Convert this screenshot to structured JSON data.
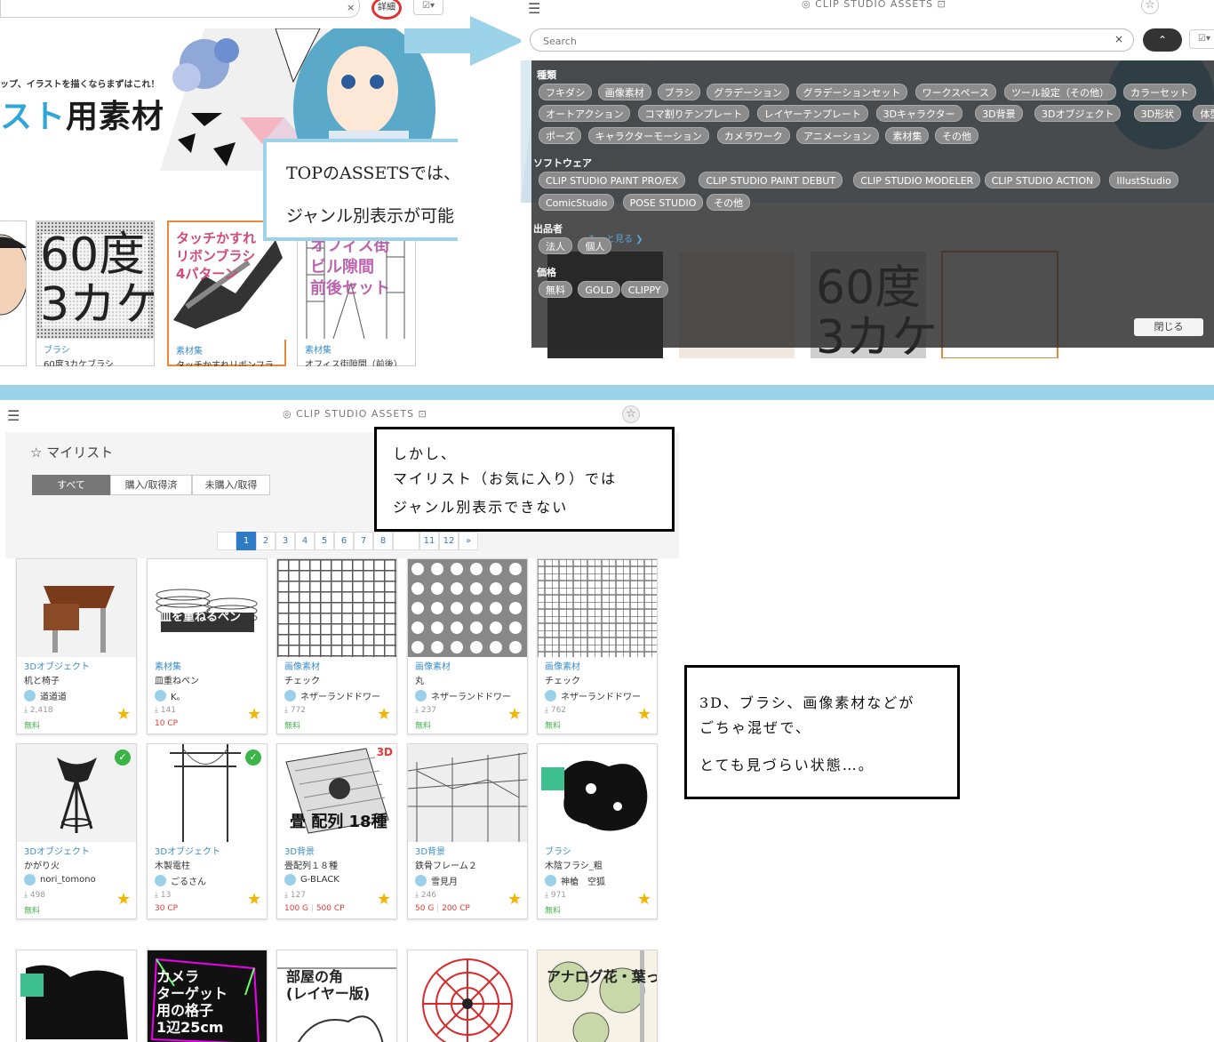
{
  "top_left": {
    "close_x": "×",
    "detail_label": "詳細",
    "check_label": "☑▾",
    "banner_line1": "ップ、イラストを描くならまずはこれ！",
    "banner_line2_accent": "スト",
    "banner_line2_rest": "用素材",
    "cards": [
      {
        "thumb_text": "60度\n3カケ",
        "category": "ブラシ",
        "name": "60度3カケブラシ"
      },
      {
        "thumb_text": "タッチかすれ\nリボンブラシ\n4パターン",
        "category": "素材集",
        "name": "タッチかすれリボンフラ"
      },
      {
        "thumb_text": "オフィス街\nビル隙間\n前後セット",
        "category": "素材集",
        "name": "オフィス街隙間（前後）"
      }
    ],
    "callout_line1": "TOPのASSETSでは、",
    "callout_line2": "ジャンル別表示が可能"
  },
  "top_right": {
    "header_title": "CLIP STUDIO ASSETS",
    "search_placeholder": "Search",
    "close_x": "×",
    "up_label": "⌃",
    "check_label": "☑▾",
    "sections": {
      "kind": "種類",
      "software": "ソフトウェア",
      "author": "出品者",
      "price": "価格"
    },
    "kind_chips": [
      "フキダシ",
      "画像素材",
      "ブラシ",
      "グラデーション",
      "グラデーションセット",
      "ワークスペース",
      "ツール設定（その他）",
      "カラーセット",
      "オートアクション",
      "コマ割りテンプレート",
      "レイヤーテンプレート",
      "3Dキャラクター",
      "3D背景",
      "3Dオブジェクト",
      "3D形状",
      "体型",
      "ポーズ",
      "キャラクターモーション",
      "カメラワーク",
      "アニメーション",
      "素材集",
      "その他"
    ],
    "software_chips": [
      "CLIP STUDIO PAINT PRO/EX",
      "CLIP STUDIO PAINT DEBUT",
      "CLIP STUDIO MODELER",
      "CLIP STUDIO ACTION",
      "IllustStudio",
      "ComicStudio",
      "POSE STUDIO",
      "その他"
    ],
    "author_chips": [
      "法人",
      "個人"
    ],
    "more_link": "もっと見る ❯",
    "price_chips": [
      "無料",
      "GOLD",
      "CLIPPY"
    ],
    "close_button": "閉じる"
  },
  "bottom": {
    "header_title": "CLIP STUDIO ASSETS",
    "mylist_title": "☆ マイリスト",
    "tabs": [
      "すべて",
      "購入/取得済",
      "未購入/取得"
    ],
    "pages": [
      "",
      "1",
      "2",
      "3",
      "4",
      "5",
      "6",
      "7",
      "8",
      "",
      "11",
      "12",
      "»"
    ],
    "callout1": [
      "しかし、",
      "マイリスト（お気に入り）では",
      "ジャンル別表示できない"
    ],
    "callout2": [
      "3D、ブラシ、画像素材などが",
      "ごちゃ混ぜで、",
      "とても見づらい状態…。"
    ],
    "cards": [
      {
        "category": "3Dオブジェクト",
        "name": "机と椅子",
        "author": "道道道",
        "downloads": "2,418",
        "price": "無料",
        "price_cp": ""
      },
      {
        "category": "素材集",
        "name": "皿重ねペン",
        "author": "K。",
        "downloads": "141",
        "price": "",
        "price_cp": "10 CP",
        "thumb_text": "皿を重ねるペン"
      },
      {
        "category": "画像素材",
        "name": "チェック",
        "author": "ネザーランドドワー",
        "downloads": "772",
        "price": "無料",
        "price_cp": ""
      },
      {
        "category": "画像素材",
        "name": "丸",
        "author": "ネザーランドドワー",
        "downloads": "237",
        "price": "無料",
        "price_cp": ""
      },
      {
        "category": "画像素材",
        "name": "チェック",
        "author": "ネザーランドドワー",
        "downloads": "762",
        "price": "無料",
        "price_cp": ""
      },
      {
        "category": "3Dオブジェクト",
        "name": "かがり火",
        "author": "nori_tomono",
        "downloads": "498",
        "price": "無料",
        "price_cp": ""
      },
      {
        "category": "3Dオブジェクト",
        "name": "木製電柱",
        "author": "ごるさん",
        "downloads": "13",
        "price": "",
        "price_cp": "30 CP"
      },
      {
        "category": "3D背景",
        "name": "畳配列１８種",
        "author": "G-BLACK",
        "downloads": "127",
        "price": "100 G",
        "price_cp": "500 CP",
        "thumb_text": "畳 配列 18種",
        "badge": "3D"
      },
      {
        "category": "3D背景",
        "name": "鉄骨フレーム２",
        "author": "雪見月",
        "downloads": "246",
        "price": "50 G",
        "price_cp": "200 CP"
      },
      {
        "category": "ブラシ",
        "name": "木陰フラシ_粗",
        "author": "神槍　空狐",
        "downloads": "971",
        "price": "無料",
        "price_cp": ""
      },
      {
        "thumb_text": ""
      },
      {
        "thumb_text": "カメラ\nターゲット\n用の格子\n1辺25cm"
      },
      {
        "thumb_text": "部屋の角\n(レイヤー版)"
      },
      {
        "thumb_text": ""
      },
      {
        "thumb_text": "アナログ花・葉っぱ"
      }
    ]
  },
  "colors": {
    "accent_blue": "#9dd3e8",
    "link_blue": "#3a8ec7",
    "star": "#f5b400",
    "free_green": "#4caf50",
    "cp_red": "#e53935"
  }
}
